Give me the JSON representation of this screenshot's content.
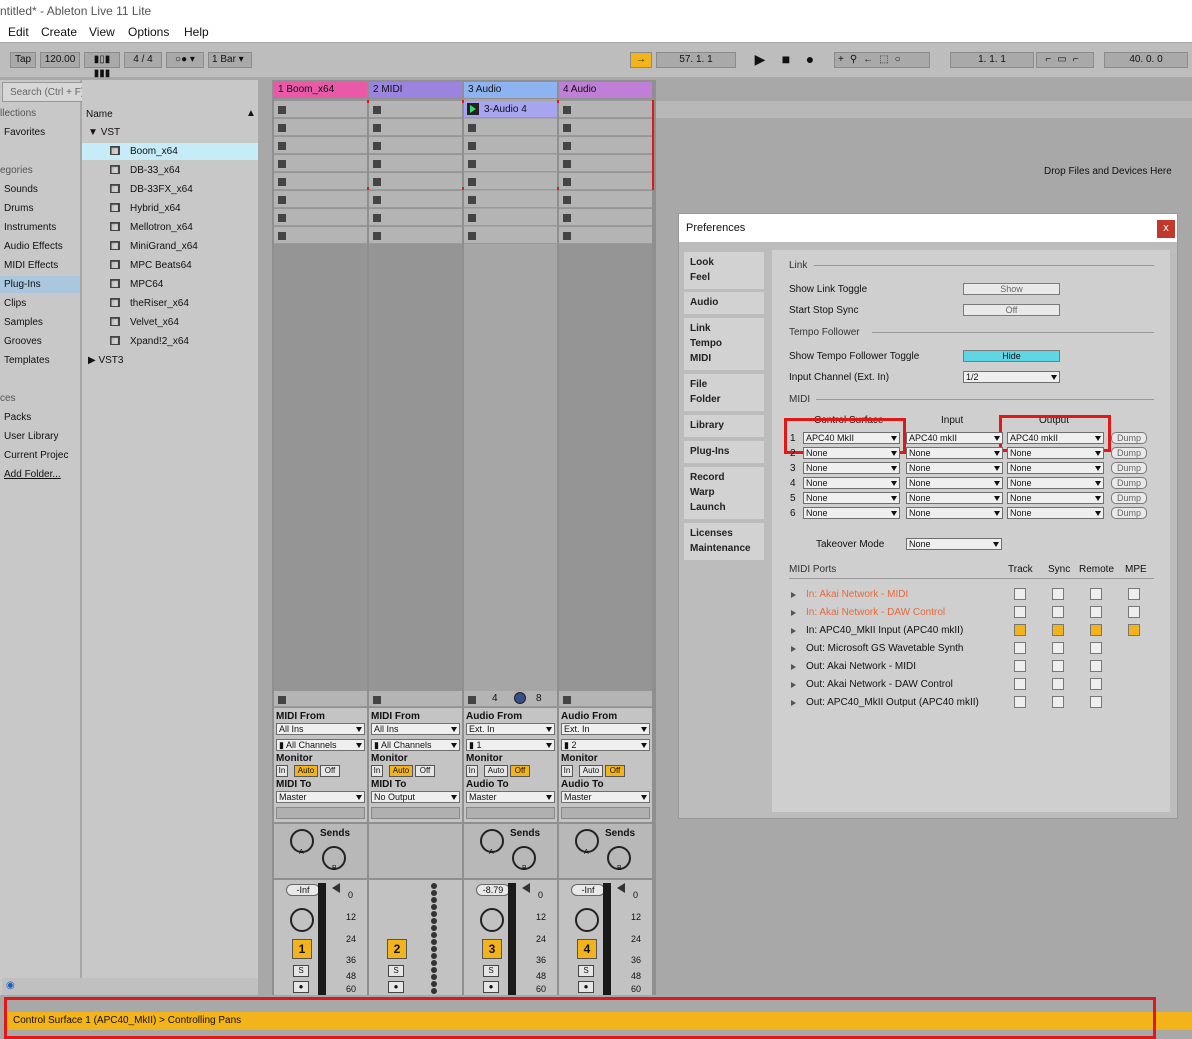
{
  "app": {
    "title": "ntitled* - Ableton Live 11 Lite"
  },
  "menu": [
    "Edit",
    "Create",
    "View",
    "Options",
    "Help"
  ],
  "transport": {
    "tap": "Tap",
    "tempo": "120.00",
    "signature": "4 / 4",
    "quantize": "1 Bar",
    "arrangement_position": "57.  1.  1",
    "loop_start": "1.   1.   1",
    "loop_length": "40.   0.   0"
  },
  "sidebar": {
    "search_placeholder": "Search (Ctrl + F)",
    "collections_header": "llections",
    "favorites": "Favorites",
    "categories_header": "egories",
    "categories": [
      "Sounds",
      "Drums",
      "Instruments",
      "Audio Effects",
      "MIDI Effects",
      "Plug-Ins",
      "Clips",
      "Samples",
      "Grooves",
      "Templates"
    ],
    "places_header": "ces",
    "places": [
      "Packs",
      "User Library",
      "Current Projec",
      "Add Folder..."
    ]
  },
  "browser": {
    "column_name": "Name",
    "root": "VST",
    "items": [
      "Boom_x64",
      "DB-33_x64",
      "DB-33FX_x64",
      "Hybrid_x64",
      "Mellotron_x64",
      "MiniGrand_x64",
      "MPC Beats64",
      "MPC64",
      "theRiser_x64",
      "Velvet_x64",
      "Xpand!2_x64"
    ],
    "vst3": "VST3"
  },
  "tracks": [
    {
      "name": "1 Boom_x64",
      "color": "#e85aa8",
      "from_label": "MIDI From",
      "from": "All Ins",
      "channel": "All Channels",
      "to_label": "MIDI To",
      "to": "Master",
      "number": "1",
      "volume": "-Inf",
      "has_sends": true
    },
    {
      "name": "2 MIDI",
      "color": "#9b83e0",
      "from_label": "MIDI From",
      "from": "All Ins",
      "channel": "All Channels",
      "to_label": "MIDI To",
      "to": "No Output",
      "number": "2",
      "volume": "",
      "has_sends": false
    },
    {
      "name": "3 Audio",
      "color": "#8db4f0",
      "from_label": "Audio From",
      "from": "Ext. In",
      "channel": "1",
      "to_label": "Audio To",
      "to": "Master",
      "number": "3",
      "volume": "-8.79",
      "has_sends": true
    },
    {
      "name": "4 Audio",
      "color": "#bf7fd6",
      "from_label": "Audio From",
      "from": "Ext. In",
      "channel": "2",
      "to_label": "Audio To",
      "to": "Master",
      "number": "4",
      "volume": "-Inf",
      "has_sends": true
    }
  ],
  "clip": {
    "name": "3-Audio 4"
  },
  "mixer": {
    "monitor_label": "Monitor",
    "monitor_in": "In",
    "monitor_auto": "Auto",
    "monitor_off": "Off",
    "sends_label": "Sends",
    "send_a": "A",
    "send_b": "B",
    "solo": "S",
    "scale": [
      "0",
      "12",
      "24",
      "36",
      "48",
      "60"
    ],
    "track3_footer": [
      "4",
      "8"
    ]
  },
  "drop_hint": "Drop Files and Devices Here",
  "prefs": {
    "title": "Preferences",
    "close": "x",
    "nav": [
      [
        "Look",
        "Feel"
      ],
      [
        "Audio"
      ],
      [
        "Link",
        "Tempo",
        "MIDI"
      ],
      [
        "File",
        "Folder"
      ],
      [
        "Library"
      ],
      [
        "Plug-Ins"
      ],
      [
        "Record",
        "Warp",
        "Launch"
      ],
      [
        "Licenses",
        "Maintenance"
      ]
    ],
    "link_header": "Link",
    "show_link_toggle": "Show Link Toggle",
    "show_link_value": "Show",
    "start_stop_sync": "Start Stop Sync",
    "start_stop_value": "Off",
    "tempo_header": "Tempo Follower",
    "show_tempo_toggle": "Show Tempo Follower Toggle",
    "show_tempo_value": "Hide",
    "input_channel": "Input Channel (Ext. In)",
    "input_channel_value": "1/2",
    "midi_header": "MIDI",
    "col_surface": "Control Surface",
    "col_input": "Input",
    "col_output": "Output",
    "dump": "Dump",
    "surfaces": [
      {
        "n": "1",
        "surface": "APC40 MkII",
        "input": "APC40 mkII",
        "output": "APC40 mkII"
      },
      {
        "n": "2",
        "surface": "None",
        "input": "None",
        "output": "None"
      },
      {
        "n": "3",
        "surface": "None",
        "input": "None",
        "output": "None"
      },
      {
        "n": "4",
        "surface": "None",
        "input": "None",
        "output": "None"
      },
      {
        "n": "5",
        "surface": "None",
        "input": "None",
        "output": "None"
      },
      {
        "n": "6",
        "surface": "None",
        "input": "None",
        "output": "None"
      }
    ],
    "takeover_label": "Takeover Mode",
    "takeover_value": "None",
    "ports_header": "MIDI Ports",
    "col_track": "Track",
    "col_sync": "Sync",
    "col_remote": "Remote",
    "col_mpe": "MPE",
    "ports": [
      {
        "label": "In:   Akai Network - MIDI",
        "error": true,
        "track": false,
        "sync": false,
        "remote": false,
        "mpe": false
      },
      {
        "label": "In:   Akai Network - DAW Control",
        "error": true,
        "track": false,
        "sync": false,
        "remote": false,
        "mpe": false
      },
      {
        "label": "In:   APC40_MkII Input (APC40 mkII)",
        "error": false,
        "track": true,
        "sync": true,
        "remote": true,
        "mpe": true
      },
      {
        "label": "Out: Microsoft GS Wavetable Synth",
        "error": false,
        "track": false,
        "sync": false,
        "remote": false,
        "mpe": null
      },
      {
        "label": "Out: Akai Network - MIDI",
        "error": false,
        "track": false,
        "sync": false,
        "remote": false,
        "mpe": null
      },
      {
        "label": "Out: Akai Network - DAW Control",
        "error": false,
        "track": false,
        "sync": false,
        "remote": false,
        "mpe": null
      },
      {
        "label": "Out: APC40_MkII Output (APC40 mkII)",
        "error": false,
        "track": false,
        "sync": false,
        "remote": false,
        "mpe": null
      }
    ]
  },
  "status": {
    "message": "Control Surface 1 (APC40_MkII) > Controlling Pans"
  },
  "colors": {
    "accent": "#f3b31a",
    "highlight": "#5fd6e6",
    "error": "#e86a3a",
    "selection_box": "#e01818"
  }
}
